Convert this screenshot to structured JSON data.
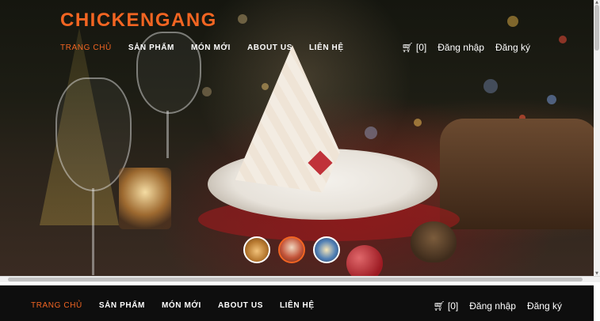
{
  "brand": {
    "logo": "CHICKENGANG",
    "accent": "#f26522"
  },
  "nav": {
    "items": [
      "TRANG CHỦ",
      "SẢN PHẨM",
      "MÓN MỚI",
      "ABOUT US",
      "LIÊN HỆ"
    ],
    "active_index": 0
  },
  "account": {
    "cart_icon": "cart-icon",
    "cart_count": "[0]",
    "login": "Đăng nhập",
    "register": "Đăng ký"
  },
  "hero": {
    "thumbnails": [
      "thumb-chicken",
      "thumb-christmas-dish",
      "thumb-meal"
    ],
    "active_thumbnail": 1
  },
  "sticky_nav": {
    "items": [
      "TRANG CHỦ",
      "SẢN PHẨM",
      "MÓN MỚI",
      "ABOUT US",
      "LIÊN HỆ"
    ],
    "cart_count": "[0]",
    "login": "Đăng nhập",
    "register": "Đăng ký"
  }
}
